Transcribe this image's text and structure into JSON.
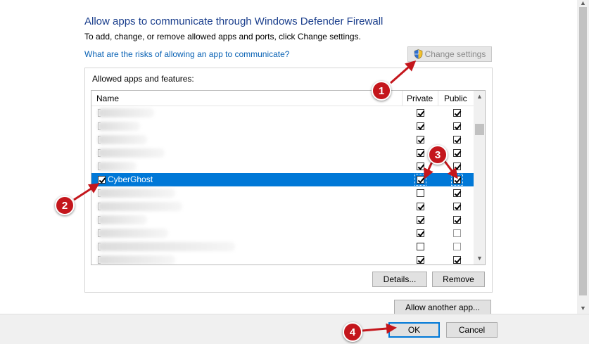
{
  "header": {
    "title": "Allow apps to communicate through Windows Defender Firewall",
    "subtitle": "To add, change, or remove allowed apps and ports, click Change settings.",
    "risk_link": "What are the risks of allowing an app to communicate?",
    "change_settings_label": "Change settings"
  },
  "allowed_apps": {
    "group_label": "Allowed apps and features:",
    "columns": {
      "name": "Name",
      "private": "Private",
      "public": "Public"
    },
    "rows": [
      {
        "name": "",
        "blurred": true,
        "enabled": false,
        "private": true,
        "public": true
      },
      {
        "name": "",
        "blurred": true,
        "enabled": false,
        "private": true,
        "public": true
      },
      {
        "name": "",
        "blurred": true,
        "enabled": false,
        "private": true,
        "public": true
      },
      {
        "name": "",
        "blurred": true,
        "enabled": false,
        "private": true,
        "public": true
      },
      {
        "name": "",
        "blurred": true,
        "enabled": false,
        "private": true,
        "public": true
      },
      {
        "name": "CyberGhost",
        "blurred": false,
        "enabled": true,
        "private": true,
        "public": true,
        "selected": true
      },
      {
        "name": "",
        "blurred": true,
        "enabled": false,
        "private": false,
        "public": true
      },
      {
        "name": "",
        "blurred": true,
        "enabled": false,
        "private": true,
        "public": true
      },
      {
        "name": "",
        "blurred": true,
        "enabled": false,
        "private": true,
        "public": true
      },
      {
        "name": "",
        "blurred": true,
        "enabled": false,
        "private": true,
        "public": false
      },
      {
        "name": "",
        "blurred": true,
        "enabled": false,
        "private": false,
        "public": false
      },
      {
        "name": "",
        "blurred": true,
        "enabled": false,
        "private": true,
        "public": true
      }
    ],
    "details_label": "Details...",
    "remove_label": "Remove"
  },
  "allow_another_label": "Allow another app...",
  "footer": {
    "ok_label": "OK",
    "cancel_label": "Cancel"
  },
  "annotations": {
    "step1": "1",
    "step2": "2",
    "step3": "3",
    "step4": "4"
  },
  "colors": {
    "accent": "#0078d7",
    "title": "#1a3e8c",
    "link": "#0b63b5",
    "badge": "#c4161c"
  }
}
